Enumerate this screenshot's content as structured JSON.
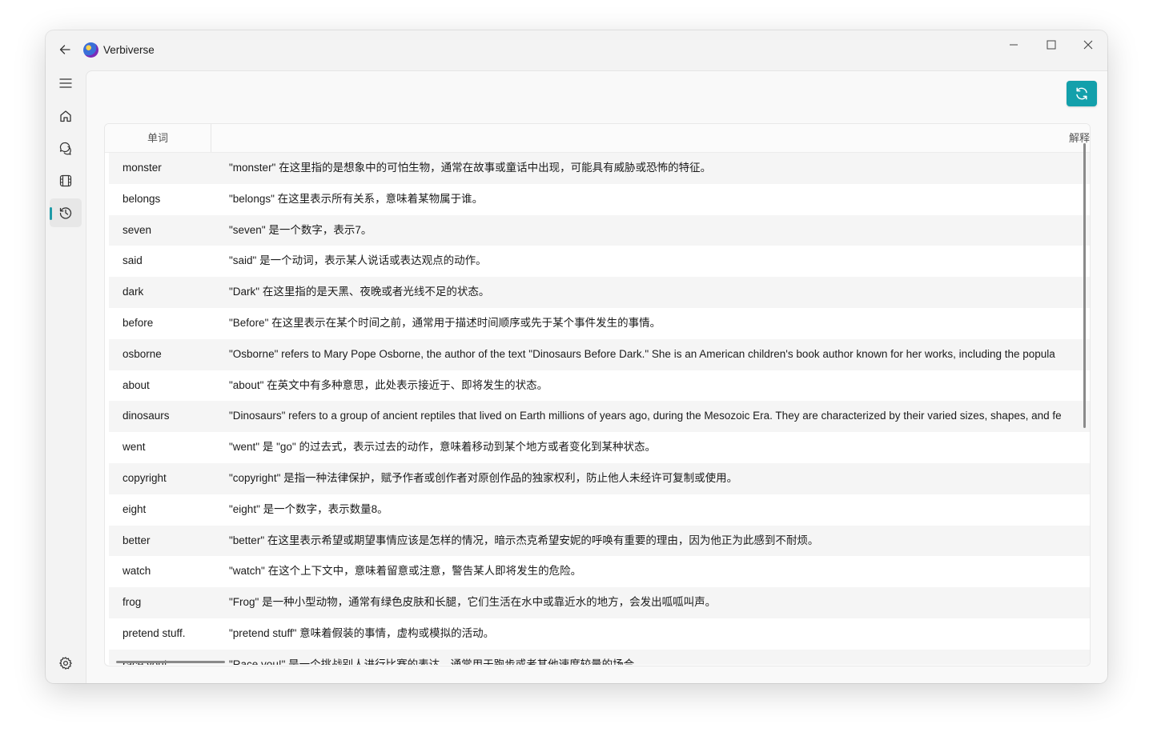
{
  "app": {
    "title": "Verbiverse"
  },
  "table": {
    "headers": {
      "word": "单词",
      "definition": "解释"
    },
    "rows": [
      {
        "word": "monster",
        "definition": "\"monster\" 在这里指的是想象中的可怕生物，通常在故事或童话中出现，可能具有威胁或恐怖的特征。"
      },
      {
        "word": "belongs",
        "definition": "\"belongs\" 在这里表示所有关系，意味着某物属于谁。"
      },
      {
        "word": "seven",
        "definition": "\"seven\" 是一个数字，表示7。"
      },
      {
        "word": "said",
        "definition": "\"said\" 是一个动词，表示某人说话或表达观点的动作。"
      },
      {
        "word": "dark",
        "definition": "\"Dark\" 在这里指的是天黑、夜晚或者光线不足的状态。"
      },
      {
        "word": "before",
        "definition": "\"Before\" 在这里表示在某个时间之前，通常用于描述时间顺序或先于某个事件发生的事情。"
      },
      {
        "word": "osborne",
        "definition": "\"Osborne\" refers to Mary Pope Osborne, the author of the text \"Dinosaurs Before Dark.\" She is an American children's book author known for her works, including the popula"
      },
      {
        "word": "about",
        "definition": "\"about\" 在英文中有多种意思，此处表示接近于、即将发生的状态。"
      },
      {
        "word": "dinosaurs",
        "definition": "\"Dinosaurs\" refers to a group of ancient reptiles that lived on Earth millions of years ago, during the Mesozoic Era. They are characterized by their varied sizes, shapes, and fe"
      },
      {
        "word": "went",
        "definition": "\"went\" 是 \"go\" 的过去式，表示过去的动作，意味着移动到某个地方或者变化到某种状态。"
      },
      {
        "word": "copyright",
        "definition": "\"copyright\" 是指一种法律保护，赋予作者或创作者对原创作品的独家权利，防止他人未经许可复制或使用。"
      },
      {
        "word": "eight",
        "definition": "\"eight\" 是一个数字，表示数量8。"
      },
      {
        "word": "better",
        "definition": "\"better\" 在这里表示希望或期望事情应该是怎样的情况，暗示杰克希望安妮的呼唤有重要的理由，因为他正为此感到不耐烦。"
      },
      {
        "word": "watch",
        "definition": "\"watch\" 在这个上下文中，意味着留意或注意，警告某人即将发生的危险。"
      },
      {
        "word": "frog",
        "definition": "\"Frog\" 是一种小型动物，通常有绿色皮肤和长腿，它们生活在水中或靠近水的地方，会发出呱呱叫声。"
      },
      {
        "word": "pretend stuff.",
        "definition": "\"pretend stuff\" 意味着假装的事情，虚构或模拟的活动。"
      },
      {
        "word": "race you!",
        "definition": "\"Race you!\" 是一个挑战别人进行比赛的表达，通常用于跑步或者其他速度较量的场合。"
      }
    ]
  },
  "colors": {
    "accent": "#13a0ab",
    "indicator": "#1e9aa7"
  },
  "icons": {
    "back": "arrow-left-icon",
    "menu": "hamburger-icon",
    "home": "home-icon",
    "chat": "chat-icon",
    "video": "film-icon",
    "history": "history-icon",
    "settings": "gear-icon",
    "refresh": "refresh-icon"
  }
}
